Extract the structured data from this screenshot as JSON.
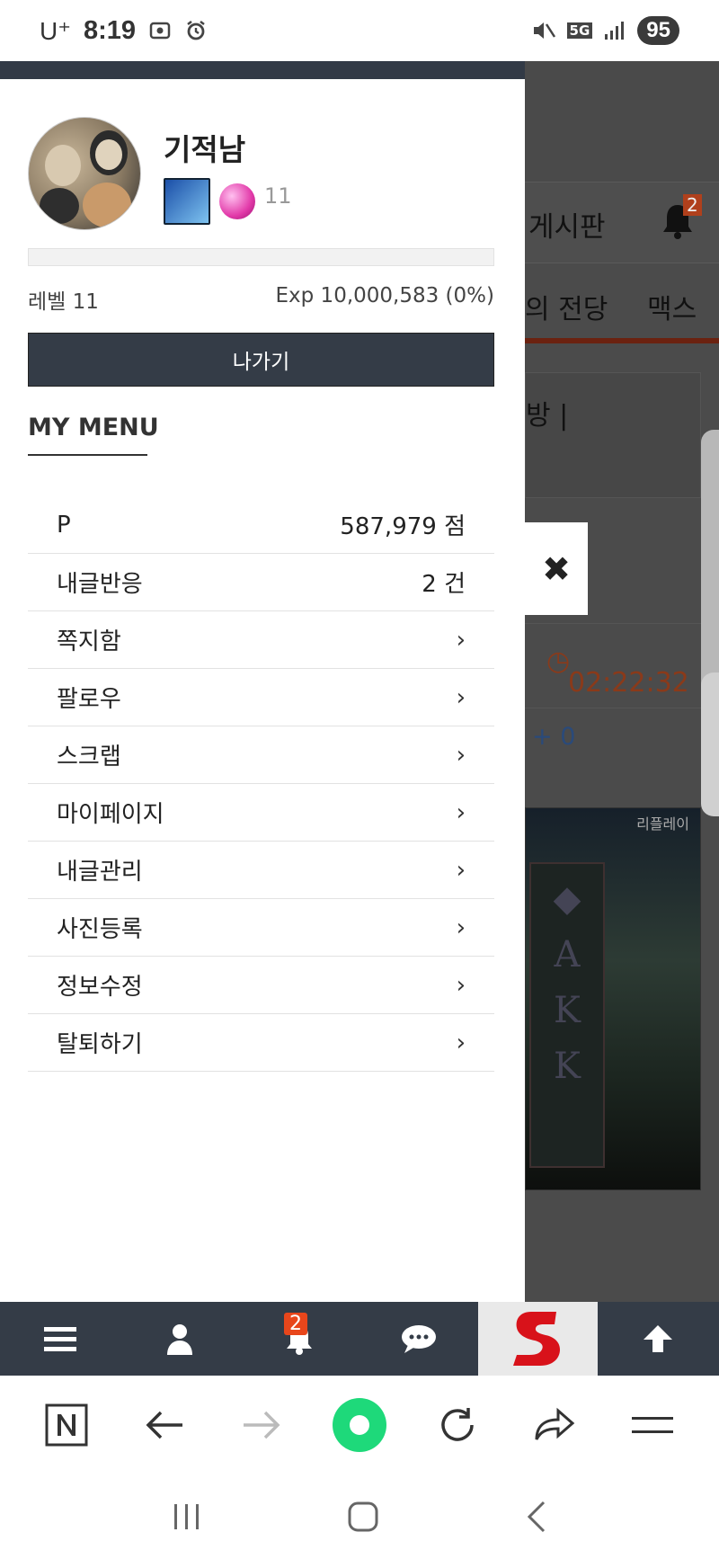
{
  "status_bar": {
    "carrier": "U⁺",
    "time": "8:19",
    "network": "5G",
    "battery": "95"
  },
  "background": {
    "nav_board": "게시판",
    "notification_count": "2",
    "tab_hall": "의 전당",
    "tab_max": "맥스",
    "box_text": "방 |",
    "timer": "02:22:32",
    "plus_count": "+ 0",
    "replay_label": "리플레이"
  },
  "profile": {
    "username": "기적남",
    "level_badge_number": "11",
    "level_label": "레벨 11",
    "exp_label": "Exp 10,000,583 (0%)",
    "exp_progress": 0
  },
  "drawer": {
    "logout_label": "나가기",
    "my_menu_title": "MY MENU",
    "close_glyph": "✖"
  },
  "menu": {
    "items": [
      {
        "label": "P",
        "value": "587,979 점"
      },
      {
        "label": "내글반응",
        "value": "2 건"
      },
      {
        "label": "쪽지함",
        "value": "›"
      },
      {
        "label": "팔로우",
        "value": "›"
      },
      {
        "label": "스크랩",
        "value": "›"
      },
      {
        "label": "마이페이지",
        "value": "›"
      },
      {
        "label": "내글관리",
        "value": "›"
      },
      {
        "label": "사진등록",
        "value": "›"
      },
      {
        "label": "정보수정",
        "value": "›"
      },
      {
        "label": "탈퇴하기",
        "value": "›"
      }
    ]
  },
  "bottom_nav": {
    "notification_count": "2"
  },
  "icons": {
    "menu": "hamburger-icon",
    "user": "user-icon",
    "bell": "bell-icon",
    "chat": "chat-icon",
    "logo": "s-logo-icon",
    "up": "arrow-up-icon"
  },
  "colors": {
    "dark_nav": "#343c47",
    "accent": "#e8461b"
  }
}
